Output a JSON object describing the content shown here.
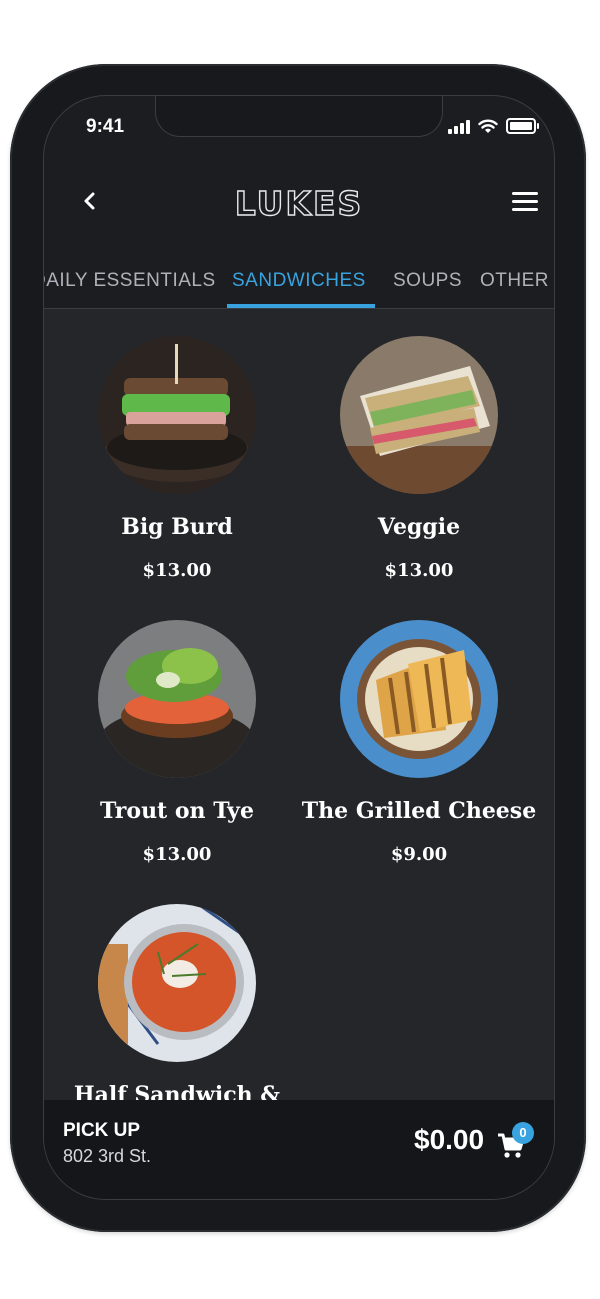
{
  "status_bar": {
    "time": "9:41"
  },
  "header": {
    "logo": "LUKES",
    "back_icon": "chevron-left-icon",
    "menu_icon": "hamburger-menu-icon"
  },
  "tabs": [
    {
      "label": "DAILY ESSENTIALS",
      "active": false
    },
    {
      "label": "SANDWICHES",
      "active": true
    },
    {
      "label": "SOUPS",
      "active": false
    },
    {
      "label": "OTHER",
      "active": false
    }
  ],
  "menu_items": [
    {
      "name": "Big Burd",
      "price": "$13.00"
    },
    {
      "name": "Veggie",
      "price": "$13.00"
    },
    {
      "name": "Trout on Tye",
      "price": "$13.00"
    },
    {
      "name": "The Grilled Cheese",
      "price": "$9.00"
    },
    {
      "name": "Half Sandwich &",
      "price": ""
    }
  ],
  "footer": {
    "pickup_label": "PICK UP",
    "address": "802 3rd St.",
    "total": "$0.00",
    "cart_count": "0",
    "cart_icon": "cart-icon"
  },
  "colors": {
    "accent": "#39a3e0",
    "background": "#24262a",
    "frame": "#17191c"
  }
}
